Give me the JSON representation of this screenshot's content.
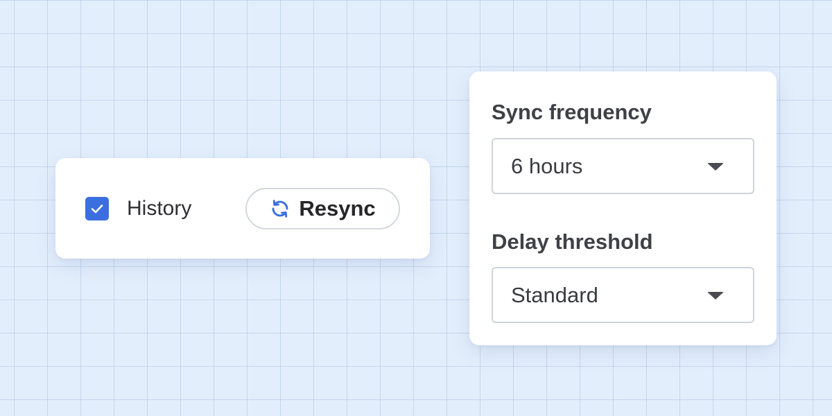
{
  "history_card": {
    "checkbox": {
      "checked": true,
      "accent": "#3b6fe0",
      "icon": "checkmark-icon"
    },
    "history_label": "History",
    "resync_button": {
      "icon": "refresh-icon",
      "label": "Resync"
    }
  },
  "settings_card": {
    "sync_frequency": {
      "label": "Sync frequency",
      "selected": "6 hours",
      "icon": "chevron-down-icon"
    },
    "delay_threshold": {
      "label": "Delay threshold",
      "selected": "Standard",
      "icon": "chevron-down-icon"
    }
  },
  "colors": {
    "background": "#e3eefc",
    "card": "#ffffff",
    "accent": "#3b6fe0"
  }
}
